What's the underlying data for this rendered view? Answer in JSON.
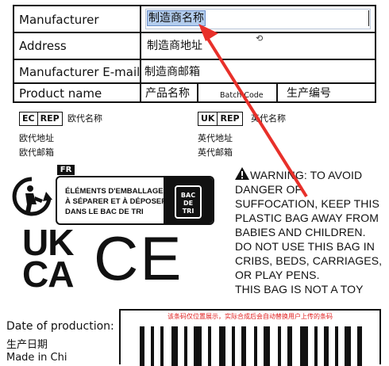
{
  "table": {
    "manufacturer_label": "Manufacturer",
    "manufacturer_value": "制造商名称",
    "address_label": "Address",
    "address_value": "制造商地址",
    "email_label": "Manufacturer E-mail",
    "email_value": "制造商邮箱",
    "product_label": "Product name",
    "product_value": "产品名称",
    "batch_label": "Batch Code",
    "batch_value": "生产编号"
  },
  "reps": {
    "ec_tag": "EC",
    "ec_rep_tag": "REP",
    "ec_name": "欧代名称",
    "ec_address": "欧代地址",
    "ec_email": "欧代邮箱",
    "uk_tag": "UK",
    "uk_rep_tag": "REP",
    "uk_name": "英代名称",
    "uk_address": "英代地址",
    "uk_email": "英代邮箱"
  },
  "recycle": {
    "fr_tag": "FR",
    "line1": "ÉLÉMENTS D'EMBALLAGE",
    "line2": "À SÉPARER ET À DÉPOSER",
    "line3": "DANS LE BAC DE TRI",
    "bac_line1": "BAC",
    "bac_line2": "DE",
    "bac_line3": "TRI"
  },
  "marks": {
    "ukca_top": "UK",
    "ukca_bottom": "CA",
    "ce": "CE"
  },
  "warning": {
    "lines": [
      "WARNING: TO AVOID",
      "DANGER OF",
      "SUFFOCATION, KEEP THIS",
      "PLASTIC BAG AWAY FROM",
      "BABIES AND CHILDREN.",
      "DO NOT USE THIS BAG IN",
      "CRIBS, BEDS, CARRIAGES,",
      "OR PLAY PENS.",
      "THIS BAG IS NOT A TOY"
    ]
  },
  "production": {
    "label_en": "Date of production:",
    "label_cn": "生产日期",
    "cut_text": "Made in Chi"
  },
  "barcode": {
    "note": "该条码仅位置展示，实际合成后会自动替换用户上传的条码"
  },
  "colors": {
    "arrow": "#e8302a",
    "selection": "#b3cdee"
  }
}
